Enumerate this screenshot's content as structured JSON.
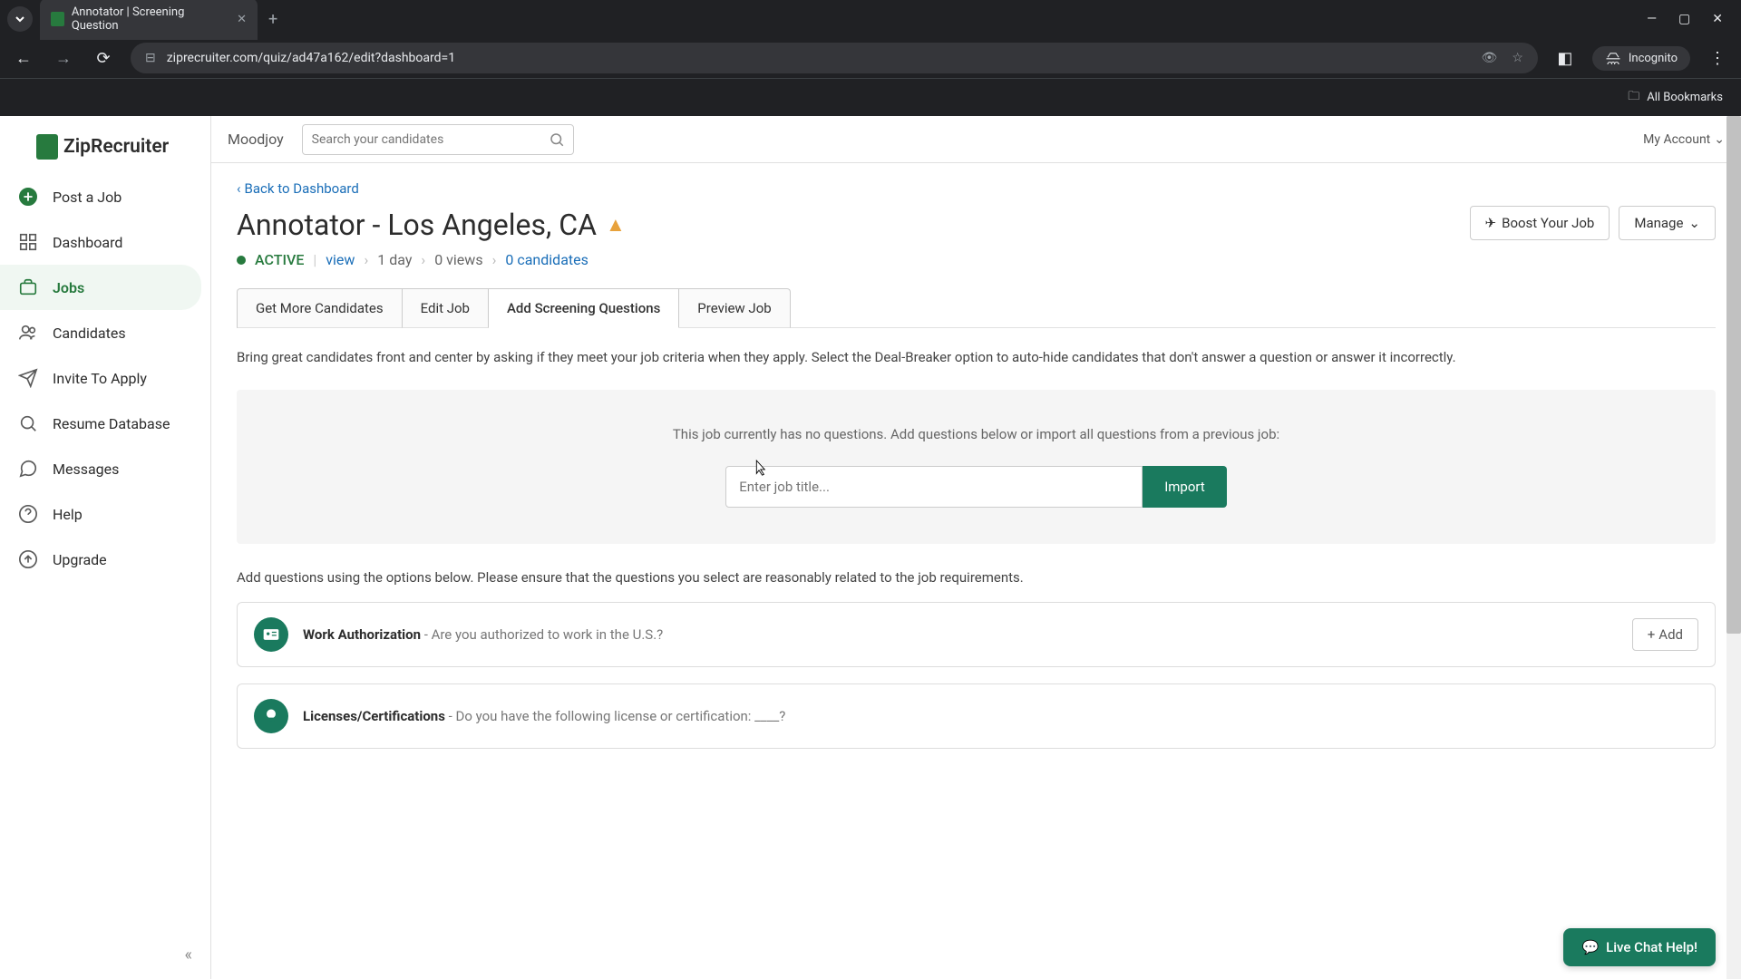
{
  "browser": {
    "tab_title": "Annotator | Screening Question",
    "url": "ziprecruiter.com/quiz/ad47a162/edit?dashboard=1",
    "incognito": "Incognito",
    "all_bookmarks": "All Bookmarks"
  },
  "logo": "ZipRecruiter",
  "sidebar": {
    "post_job": "Post a Job",
    "dashboard": "Dashboard",
    "jobs": "Jobs",
    "candidates": "Candidates",
    "invite": "Invite To Apply",
    "resume_db": "Resume Database",
    "messages": "Messages",
    "help": "Help",
    "upgrade": "Upgrade"
  },
  "topbar": {
    "workspace": "Moodjoy",
    "search_placeholder": "Search your candidates",
    "account": "My Account"
  },
  "page": {
    "back": "Back to Dashboard",
    "title": "Annotator - Los Angeles, CA",
    "status": "ACTIVE",
    "view": "view",
    "age": "1 day",
    "views": "0 views",
    "candidates": "0 candidates",
    "boost": "Boost Your Job",
    "manage": "Manage"
  },
  "tabs": {
    "get_more": "Get More Candidates",
    "edit": "Edit Job",
    "screening": "Add Screening Questions",
    "preview": "Preview Job"
  },
  "intro": "Bring great candidates front and center by asking if they meet your job criteria when they apply. Select the Deal-Breaker option to auto-hide candidates that don't answer a question or answer it incorrectly.",
  "import": {
    "msg": "This job currently has no questions. Add questions below or import all questions from a previous job:",
    "placeholder": "Enter job title...",
    "button": "Import"
  },
  "add_instr": "Add questions using the options below. Please ensure that the questions you select are reasonably related to the job requirements.",
  "questions": [
    {
      "title": "Work Authorization",
      "desc": " - Are you authorized to work in the U.S.?"
    },
    {
      "title": "Licenses/Certifications",
      "desc": " - Do you have the following license or certification: ____?"
    }
  ],
  "add_label": "Add",
  "chat": "Live Chat Help!"
}
